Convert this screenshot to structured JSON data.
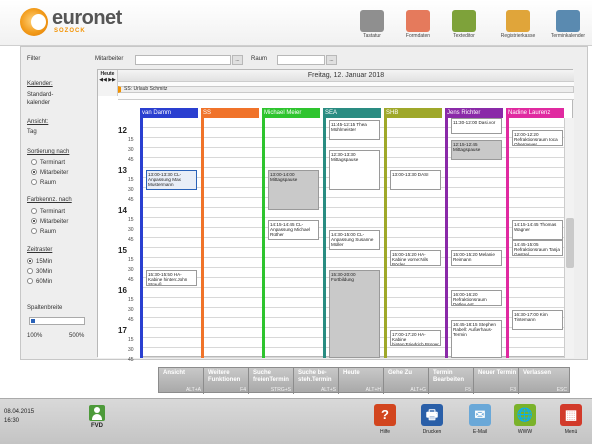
{
  "brand": {
    "name": "euronet",
    "sub": "SOZOCK"
  },
  "toolbar": [
    {
      "label": "Tastatur",
      "color": "#8f8f8f"
    },
    {
      "label": "Formdaten",
      "color": "#e57a5c"
    },
    {
      "label": "Texteditor",
      "color": "#7ea23a"
    },
    {
      "label": "Registrierkasse",
      "color": "#e0a53a"
    },
    {
      "label": "Terminkalender",
      "color": "#5a8ab0"
    }
  ],
  "filter": {
    "label": "Filter",
    "employee_label": "Mitarbeiter",
    "room_label": "Raum",
    "btn": "..."
  },
  "left": {
    "calendar_label": "Kalender:",
    "calendar_value": "Standard-\nkalender",
    "view_label": "Ansicht:",
    "view_value": "Tag",
    "sort_label": "Sortierung nach",
    "sort_options": [
      "Terminart",
      "Mitarbeiter",
      "Raum"
    ],
    "color_label": "Farbkennz. nach",
    "color_options": [
      "Terminart",
      "Mitarbeiter",
      "Raum"
    ],
    "raster_label": "Zeitraster",
    "raster_options": [
      "15Min",
      "30Min",
      "60Min"
    ],
    "width_label": "Spaltenbreite",
    "width_min": "100%",
    "width_max": "500%"
  },
  "calendar": {
    "today_label": "Heute",
    "nav": "◀◀ ▶▶",
    "date": "Freitag, 12. Januar 2018",
    "allday_event": "SS: Urlaub Schmitz",
    "hours": [
      "12",
      "13",
      "14",
      "15",
      "16",
      "17"
    ],
    "quarters": [
      "00",
      "15",
      "30",
      "45"
    ],
    "columns": [
      {
        "name": "van Damm",
        "color": "#2a3fd0"
      },
      {
        "name": "SS",
        "color": "#f0732a"
      },
      {
        "name": "Michael Meier",
        "color": "#2ec42e"
      },
      {
        "name": "SEA",
        "color": "#2a8c82"
      },
      {
        "name": "SHB",
        "color": "#9fa82a"
      },
      {
        "name": "Jens Richter",
        "color": "#8a2aa8"
      },
      {
        "name": "Nadine Laurenz",
        "color": "#e02aa0"
      }
    ],
    "events": [
      {
        "col": 0,
        "start": "13:00",
        "text": "13:00-13:30 CL-Anpassung Max Mustermann",
        "style": "blue"
      },
      {
        "col": 0,
        "start": "15:30",
        "text": "15:30-15:50 HA-Kabine hinten:John Strauß",
        "style": "plain"
      },
      {
        "col": 2,
        "start": "13:00",
        "text": "13:00-14:00 Mittagspause",
        "style": "grey"
      },
      {
        "col": 2,
        "start": "14:15",
        "text": "14:15-14:45 CL-Anpassung Michael Rüther",
        "style": "plain"
      },
      {
        "col": 3,
        "start": "11:45",
        "text": "11:45-12:15 Thea Mühlmeister",
        "style": "plain"
      },
      {
        "col": 3,
        "start": "12:30",
        "text": "12:30-13:30 Mittagspause",
        "style": "plain"
      },
      {
        "col": 3,
        "start": "14:30",
        "text": "14:30-15:00 CL-Anpassung Susanne Müller",
        "style": "plain"
      },
      {
        "col": 3,
        "start": "15:30",
        "text": "15:30-20:00 Fortbildung",
        "style": "grey"
      },
      {
        "col": 4,
        "start": "13:00",
        "text": "13:00-13:30 DASI",
        "style": "plain"
      },
      {
        "col": 4,
        "start": "15:00",
        "text": "15:00-15:20 HA-Kabine vorne:Nils Böcler",
        "style": "plain"
      },
      {
        "col": 4,
        "start": "17:00",
        "text": "17:00-17:20 HA-Kabine hinten:Friedrich Bürger",
        "style": "plain"
      },
      {
        "col": 5,
        "start": "11:30",
        "text": "11:30-12:00 Dasi.vor",
        "style": "plain"
      },
      {
        "col": 5,
        "start": "12:15",
        "text": "12:15-12:45 Mittagspause",
        "style": "grey"
      },
      {
        "col": 5,
        "start": "15:00",
        "text": "15:00-15:20 Melanie Reimann",
        "style": "plain"
      },
      {
        "col": 5,
        "start": "16:00",
        "text": "16:00-16:20 Refraktionsraum Detlev Ast",
        "style": "plain"
      },
      {
        "col": 5,
        "start": "16:45",
        "text": "16:45-18:15 Stephen Rabell: Außerhaus-Termin",
        "style": "plain"
      },
      {
        "col": 6,
        "start": "12:00",
        "text": "12:00-12:20 Refraktionsraum Ioca Obermeyer",
        "style": "plain"
      },
      {
        "col": 6,
        "start": "14:15",
        "text": "14:15-14:45 Thomas Wagner",
        "style": "plain"
      },
      {
        "col": 6,
        "start": "14:45",
        "text": "14:45-15:05 Refraktionsraum Tanja Gestrel",
        "style": "plain"
      },
      {
        "col": 6,
        "start": "16:30",
        "text": "16:30-17:00 Kim Tintemann",
        "style": "plain"
      }
    ]
  },
  "fkeys": [
    {
      "label": "Ansicht",
      "key": "ALT+A"
    },
    {
      "label": "Weitere Funktionen",
      "key": "F4"
    },
    {
      "label": "Suche freienTermin",
      "key": "STRG+S"
    },
    {
      "label": "Suche be-steh.Termin",
      "key": "ALT+S"
    },
    {
      "label": "Heute",
      "key": "ALT+H"
    },
    {
      "label": "Gehe Zu",
      "key": "ALT+G"
    },
    {
      "label": "Termin Bearbeiten",
      "key": "F5"
    },
    {
      "label": "Neuer Termin",
      "key": "F3"
    },
    {
      "label": "Verlassen",
      "key": "ESC"
    }
  ],
  "status": {
    "date": "08.04.2015",
    "time": "16:30",
    "user": "FVD"
  },
  "bottom_buttons": [
    {
      "label": "Hilfe",
      "glyph": "?",
      "color": "#d2451e"
    },
    {
      "label": "Drucken",
      "glyph": "🖶",
      "color": "#2a5fa8"
    },
    {
      "label": "E-Mail",
      "glyph": "✉",
      "color": "#6aa8d8"
    },
    {
      "label": "WWW",
      "glyph": "🌐",
      "color": "#7ab22a"
    },
    {
      "label": "Menü",
      "glyph": "▦",
      "color": "#d23a2a"
    }
  ]
}
